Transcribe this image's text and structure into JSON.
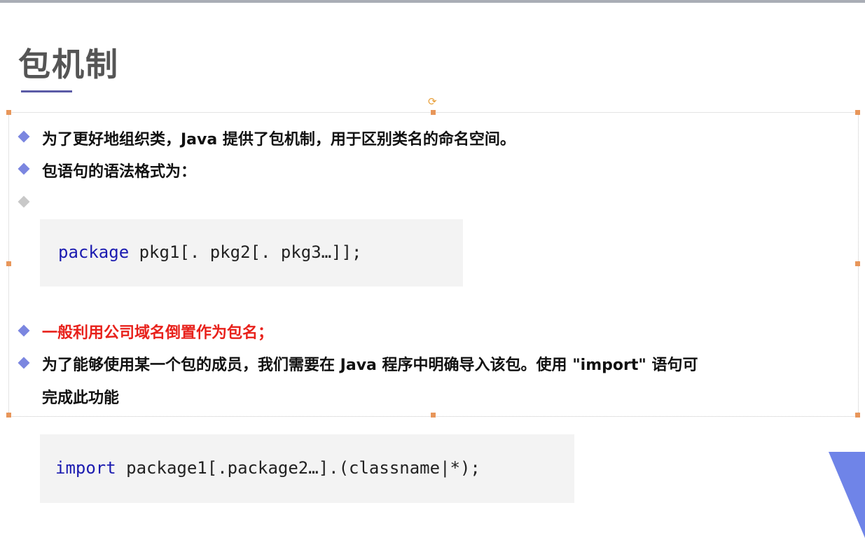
{
  "slide": {
    "title": "包机制",
    "bullets": [
      "为了更好地组织类，Java 提供了包机制，用于区别类名的命名空间。",
      "包语句的语法格式为：",
      "一般利用公司域名倒置作为包名；",
      "为了能够使用某一个包的成员，我们需要在 Java 程序中明确导入该包。使用 \"import\" 语句可",
      "完成此功能"
    ],
    "code1": {
      "keyword": "package",
      "rest": " pkg1[. pkg2[. pkg3…]];"
    },
    "code2": {
      "keyword": "import",
      "rest": " package1[.package2…].(classname|*);"
    },
    "accent_color": "#7b86e0",
    "highlight_color": "#e8211b"
  }
}
